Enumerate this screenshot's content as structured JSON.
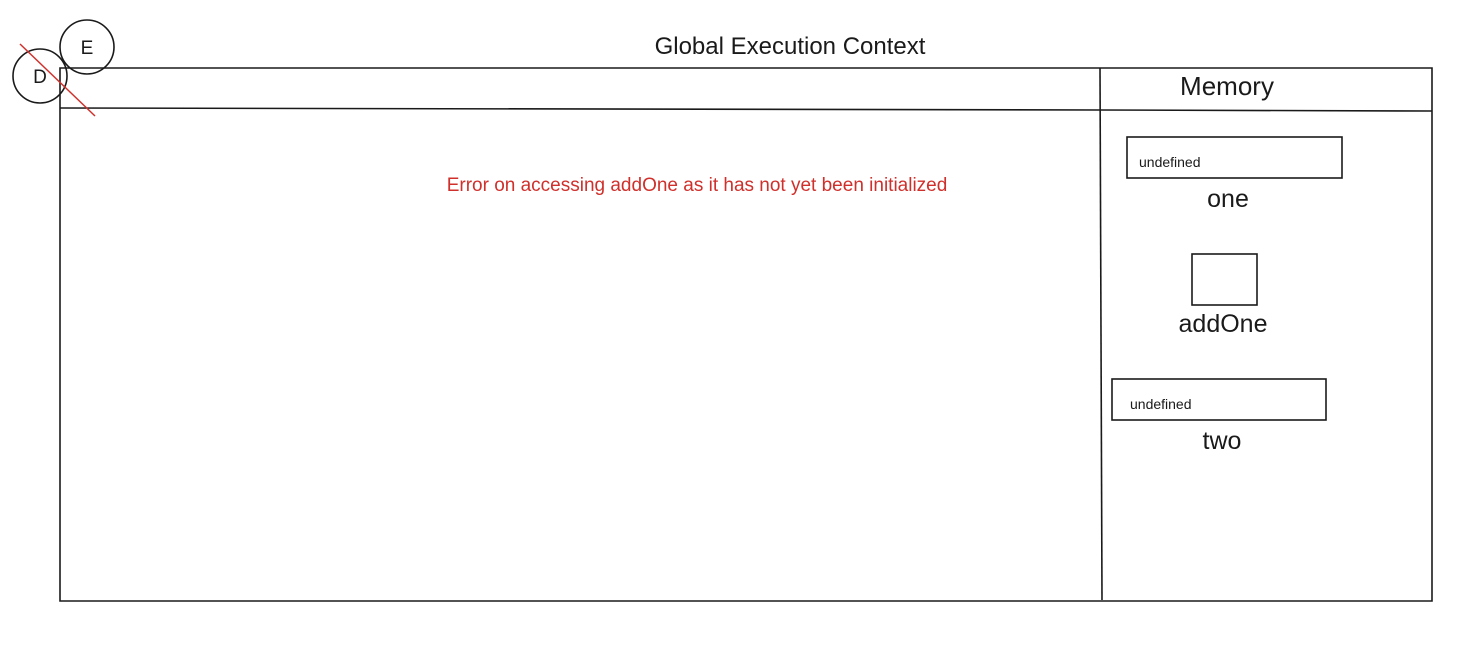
{
  "diagram": {
    "title": "Global Execution Context",
    "memory_header": "Memory",
    "error_message": "Error on accessing addOne as it has not yet been initialized",
    "error_color": "#d0302b",
    "strike_color": "#d0302b",
    "circles": [
      {
        "label": "E",
        "struck": false
      },
      {
        "label": "D",
        "struck": true
      }
    ],
    "memory_entries": [
      {
        "name": "one",
        "value": "undefined"
      },
      {
        "name": "addOne",
        "value": ""
      },
      {
        "name": "two",
        "value": "undefined"
      }
    ]
  }
}
